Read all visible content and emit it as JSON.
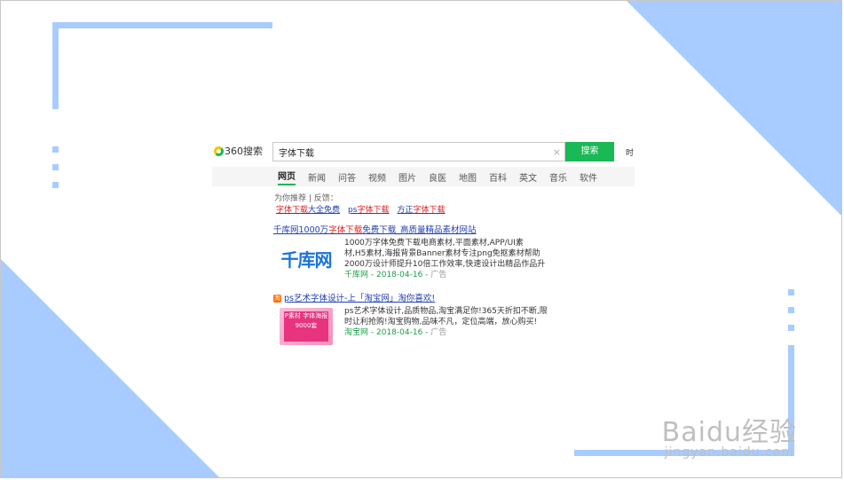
{
  "colors": {
    "accent_green": "#19b955",
    "deco_blue": "#a8ccff",
    "link_blue": "#2140b2",
    "highlight_red": "#e02020"
  },
  "logo": {
    "text": "360搜索"
  },
  "search": {
    "value": "字体下载",
    "clear_icon": "×",
    "button_label": "搜索",
    "extra_label": "时"
  },
  "tabs": [
    {
      "label": "网页",
      "active": true
    },
    {
      "label": "新闻"
    },
    {
      "label": "问答"
    },
    {
      "label": "视频"
    },
    {
      "label": "图片"
    },
    {
      "label": "良医"
    },
    {
      "label": "地图"
    },
    {
      "label": "百科"
    },
    {
      "label": "英文"
    },
    {
      "label": "音乐"
    },
    {
      "label": "软件"
    }
  ],
  "recommend": {
    "prefix": "为你推荐 | 反馈：",
    "links": [
      {
        "pre": "",
        "hl": "字体下载",
        "post": "大全免费"
      },
      {
        "pre": "ps",
        "hl": "字体下载",
        "post": ""
      },
      {
        "pre": "方正",
        "hl": "字体下载",
        "post": ""
      }
    ]
  },
  "results": [
    {
      "title_pre": "千库网1000万",
      "title_hl": "字体下载",
      "title_post": "免费下载_高质量精品素材网站",
      "thumb_text": "千库网",
      "lines": [
        "1000万字体免费下载电商素材,平面素材,APP/UI素",
        "材,H5素材,海报背景Banner素材专注png免抠素材帮助",
        "2000万设计师提升10倍工作效率,快速设计出精品作品升"
      ],
      "source": "千库网",
      "date": "2018-04-16",
      "ad": "广告"
    },
    {
      "title": "ps艺术字体设计-上「淘宝网」淘你喜欢!",
      "thumb_text": "P素材 字体海报 9000套",
      "lines": [
        "ps艺术字体设计,品质物品,淘宝满足你!365天折扣不断,限",
        "时让利抢购!淘宝购物,品味不凡，定位高端，放心购买!"
      ],
      "source": "淘宝网",
      "date": "2018-04-16",
      "ad": "广告"
    }
  ],
  "watermark": {
    "main": "Baidu经验",
    "sub": "jingyan.baidu.com"
  }
}
